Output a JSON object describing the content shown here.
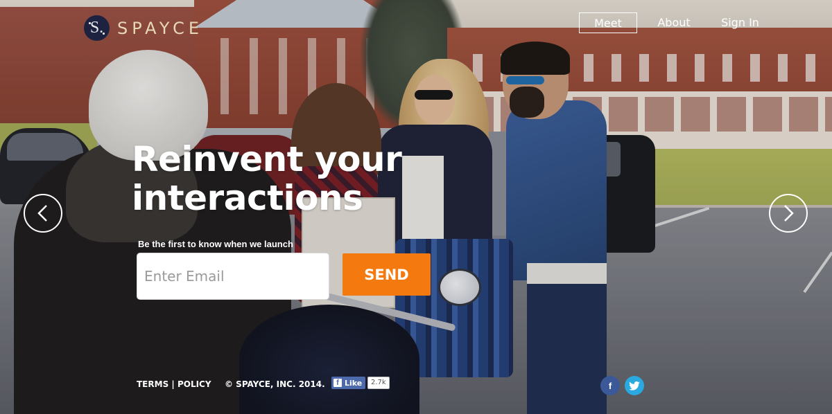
{
  "brand": {
    "logo_letter": "S.",
    "name": "SPAYCE"
  },
  "nav": {
    "meet": "Meet",
    "about": "About",
    "sign_in": "Sign In"
  },
  "hero": {
    "headline_line1": "Reinvent your",
    "headline_line2": "interactions"
  },
  "signup": {
    "tagline": "Be the first to know when we launch",
    "email_placeholder": "Enter Email",
    "send_label": "SEND"
  },
  "footer": {
    "terms": "TERMS | POLICY",
    "copyright": "© SPAYCE, INC. 2014.",
    "fb_like_label": "Like",
    "fb_like_count": "2.7k"
  },
  "social": {
    "facebook_glyph": "f",
    "twitter_glyph": "t"
  },
  "icons": {
    "prev": "chevron-left-icon",
    "next": "chevron-right-icon",
    "facebook": "facebook-icon",
    "twitter": "twitter-icon"
  },
  "colors": {
    "accent": "#f47a0f",
    "logo_badge": "#1c2240",
    "logo_text": "#e7d9b7",
    "facebook": "#3b5998",
    "twitter": "#2aa9e0"
  }
}
